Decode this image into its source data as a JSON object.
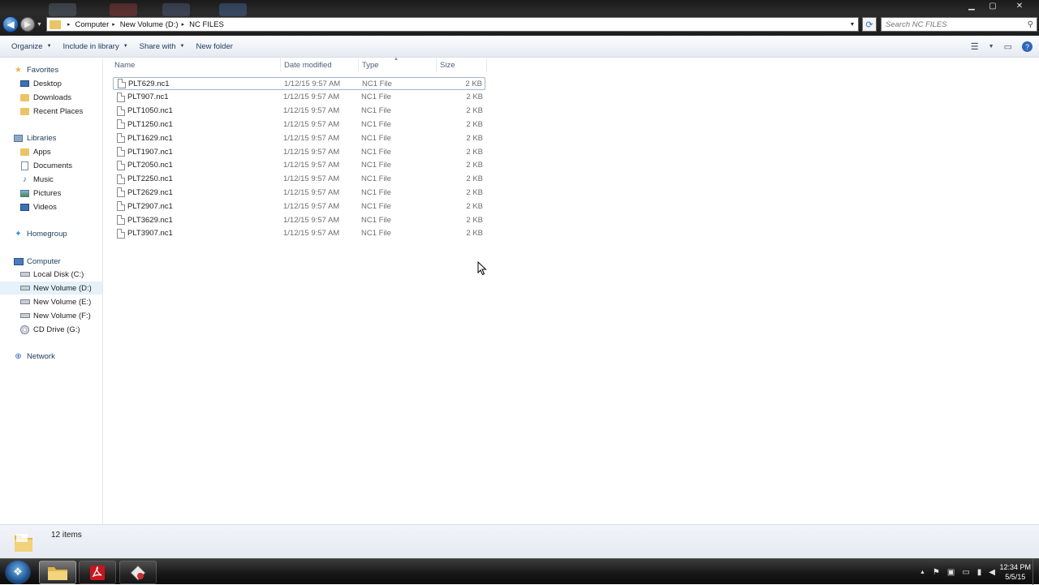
{
  "window": {
    "controls": {
      "minimize": "▁",
      "maximize": "▢",
      "close": "✕"
    }
  },
  "colors": {
    "accent": "#1e395b",
    "selection": "#e5f1fb",
    "folder": "#e9c565"
  },
  "address_bar": {
    "breadcrumbs": [
      "Computer",
      "New Volume (D:)",
      "NC FILES"
    ],
    "separator": "▸"
  },
  "search": {
    "placeholder": "Search NC FILES",
    "icon": "search-icon"
  },
  "toolbar": {
    "organize": "Organize",
    "include_in_library": "Include in library",
    "share_with": "Share with",
    "new_folder": "New folder",
    "dropdown_arrow": "▼"
  },
  "nav_pane": {
    "favorites": {
      "label": "Favorites",
      "items": [
        "Desktop",
        "Downloads",
        "Recent Places"
      ]
    },
    "libraries": {
      "label": "Libraries",
      "items": [
        "Apps",
        "Documents",
        "Music",
        "Pictures",
        "Videos"
      ]
    },
    "homegroup": {
      "label": "Homegroup"
    },
    "computer": {
      "label": "Computer",
      "items": [
        "Local Disk (C:)",
        "New Volume (D:)",
        "New Volume (E:)",
        "New Volume (F:)",
        "CD Drive (G:)"
      ],
      "selected": "New Volume (D:)"
    },
    "network": {
      "label": "Network"
    }
  },
  "columns": {
    "name": "Name",
    "date_modified": "Date modified",
    "type": "Type",
    "size": "Size"
  },
  "files": [
    {
      "name": "PLT629.nc1",
      "date": "1/12/15 9:57 AM",
      "type": "NC1 File",
      "size": "2 KB"
    },
    {
      "name": "PLT907.nc1",
      "date": "1/12/15 9:57 AM",
      "type": "NC1 File",
      "size": "2 KB"
    },
    {
      "name": "PLT1050.nc1",
      "date": "1/12/15 9:57 AM",
      "type": "NC1 File",
      "size": "2 KB"
    },
    {
      "name": "PLT1250.nc1",
      "date": "1/12/15 9:57 AM",
      "type": "NC1 File",
      "size": "2 KB"
    },
    {
      "name": "PLT1629.nc1",
      "date": "1/12/15 9:57 AM",
      "type": "NC1 File",
      "size": "2 KB"
    },
    {
      "name": "PLT1907.nc1",
      "date": "1/12/15 9:57 AM",
      "type": "NC1 File",
      "size": "2 KB"
    },
    {
      "name": "PLT2050.nc1",
      "date": "1/12/15 9:57 AM",
      "type": "NC1 File",
      "size": "2 KB"
    },
    {
      "name": "PLT2250.nc1",
      "date": "1/12/15 9:57 AM",
      "type": "NC1 File",
      "size": "2 KB"
    },
    {
      "name": "PLT2629.nc1",
      "date": "1/12/15 9:57 AM",
      "type": "NC1 File",
      "size": "2 KB"
    },
    {
      "name": "PLT2907.nc1",
      "date": "1/12/15 9:57 AM",
      "type": "NC1 File",
      "size": "2 KB"
    },
    {
      "name": "PLT3629.nc1",
      "date": "1/12/15 9:57 AM",
      "type": "NC1 File",
      "size": "2 KB"
    },
    {
      "name": "PLT3907.nc1",
      "date": "1/12/15 9:57 AM",
      "type": "NC1 File",
      "size": "2 KB"
    }
  ],
  "selected_file": "PLT629.nc1",
  "details": {
    "count": "12 items"
  },
  "taskbar": {
    "apps": [
      "file-explorer-icon",
      "acrobat-icon",
      "cnc-app-icon"
    ],
    "clock": {
      "time": "12:34 PM",
      "date": "5/5/15"
    }
  }
}
